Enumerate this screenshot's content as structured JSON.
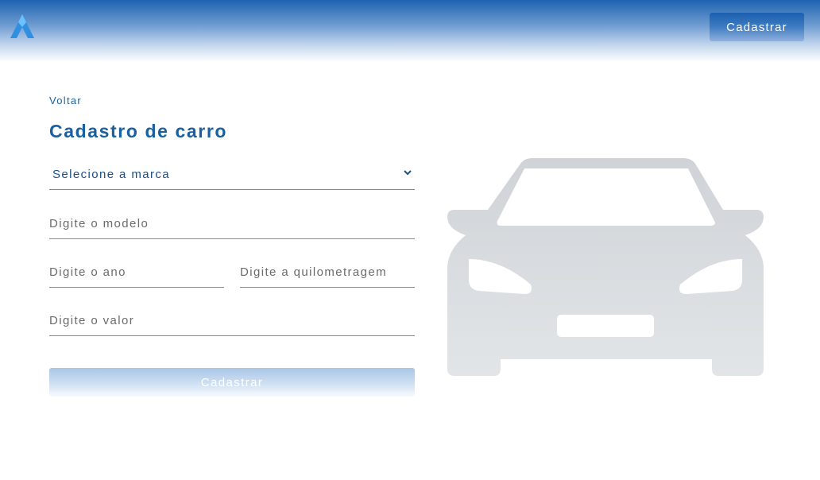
{
  "header": {
    "logo_icon": "triangle-a-logo-icon",
    "register_button_label": "Cadastrar"
  },
  "main": {
    "back_link_label": "Voltar",
    "title": "Cadastro de carro",
    "brand_select": {
      "value": "Selecione a marca",
      "icon": "chevron-down-icon"
    },
    "model_input": {
      "value": "",
      "placeholder": "Digite o modelo"
    },
    "year_input": {
      "value": "",
      "placeholder": "Digite o ano"
    },
    "mileage_input": {
      "value": "",
      "placeholder": "Digite a quilometragem"
    },
    "price_input": {
      "value": "",
      "placeholder": "Digite o valor"
    },
    "submit_label": "Cadastrar",
    "illustration_icon": "car-front-icon"
  },
  "colors": {
    "accent": "#1a5f9f",
    "header_top": "#1e63b0",
    "car_gray": "#d3d6da"
  }
}
